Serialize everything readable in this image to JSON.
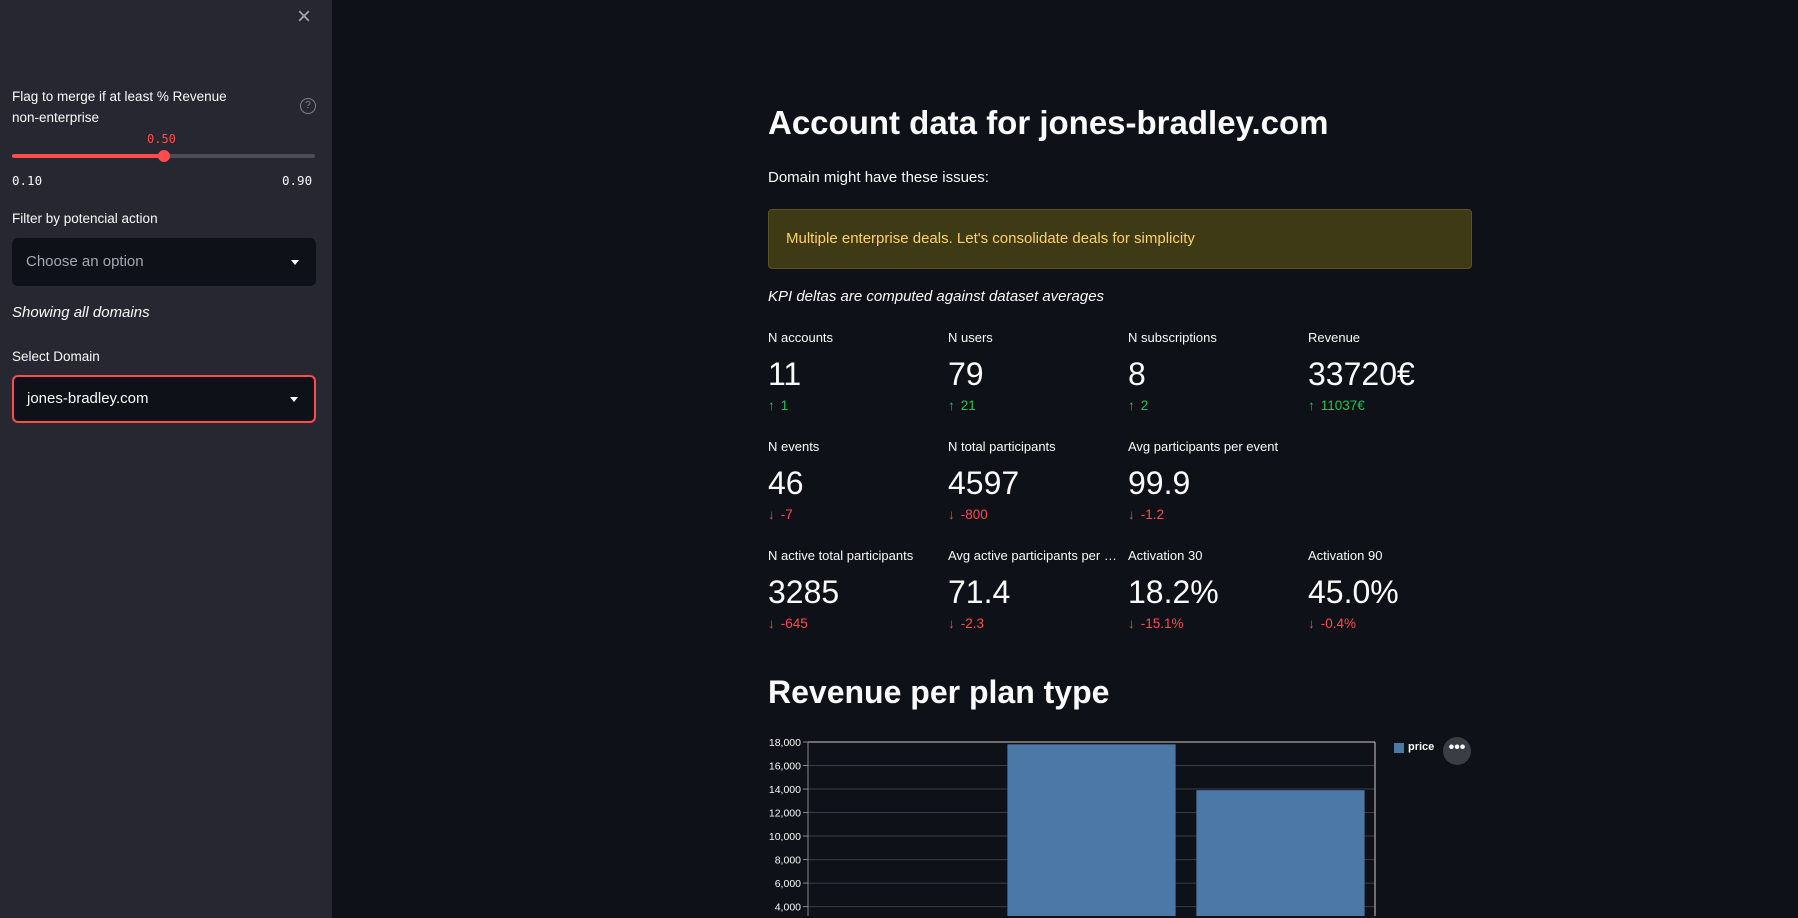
{
  "sidebar": {
    "close_symbol": "×",
    "slider": {
      "label": "Flag to merge if at least % Revenue non-enterprise",
      "value": "0.50",
      "value_fraction": 0.5,
      "min": "0.10",
      "max": "0.90"
    },
    "help_symbol": "?",
    "filter": {
      "label": "Filter by potencial action",
      "placeholder": "Choose an option"
    },
    "showing_text": "Showing all domains",
    "domain_select": {
      "label": "Select Domain",
      "value": "jones-bradley.com"
    }
  },
  "main": {
    "title": "Account data for jones-bradley.com",
    "subtitle": "Domain might have these issues:",
    "warning": "Multiple enterprise deals. Let's consolidate deals for simplicity",
    "caption": "KPI deltas are computed against dataset averages",
    "metrics": [
      {
        "label": "N accounts",
        "value": "11",
        "delta": "1",
        "direction": "up"
      },
      {
        "label": "N users",
        "value": "79",
        "delta": "21",
        "direction": "up"
      },
      {
        "label": "N subscriptions",
        "value": "8",
        "delta": "2",
        "direction": "up"
      },
      {
        "label": "Revenue",
        "value": "33720€",
        "delta": "11037€",
        "direction": "up"
      },
      {
        "label": "N events",
        "value": "46",
        "delta": "-7",
        "direction": "down"
      },
      {
        "label": "N total participants",
        "value": "4597",
        "delta": "-800",
        "direction": "down"
      },
      {
        "label": "Avg participants per event",
        "value": "99.9",
        "delta": "-1.2",
        "direction": "down"
      },
      {
        "label": "N active total participants",
        "value": "3285",
        "delta": "-645",
        "direction": "down"
      },
      {
        "label": "Avg active participants per event",
        "value": "71.4",
        "delta": "-2.3",
        "direction": "down"
      },
      {
        "label": "Activation 30",
        "value": "18.2%",
        "delta": "-15.1%",
        "direction": "down"
      },
      {
        "label": "Activation 90",
        "value": "45.0%",
        "delta": "-0.4%",
        "direction": "down"
      }
    ],
    "section_title": "Revenue per plan type",
    "more_symbol": "•••"
  },
  "colors": {
    "accent": "#ff4b4b",
    "delta_up": "#21c354",
    "delta_down": "#ff4b4b",
    "bar": "#4c78a8",
    "warning_text": "#ffd16a"
  },
  "chart_data": {
    "type": "bar",
    "categories": [
      "",
      "",
      ""
    ],
    "series": [
      {
        "name": "price",
        "values": [
          null,
          17800,
          13900
        ]
      }
    ],
    "yticks": [
      "4,000",
      "6,000",
      "8,000",
      "10,000",
      "12,000",
      "14,000",
      "16,000",
      "18,000"
    ],
    "ylim_visible": [
      3200,
      18000
    ],
    "legend": "top-right",
    "grid": true
  }
}
